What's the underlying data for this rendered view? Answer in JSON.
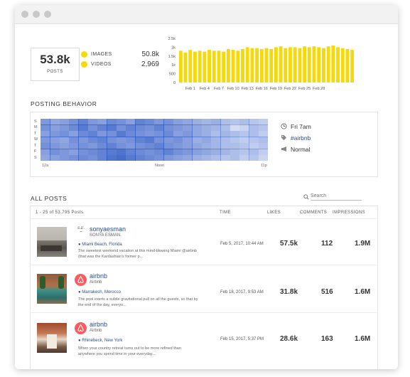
{
  "summary": {
    "total_posts": "53.8k",
    "total_label": "POSTS",
    "images_label": "IMAGES",
    "images_value": "50.8k",
    "videos_label": "VIDEOS",
    "videos_value": "2,969",
    "images_color": "#f5d90a",
    "videos_color": "#f5d90a"
  },
  "chart_data": {
    "type": "bar",
    "y_ticks": [
      "2.5k",
      "2k",
      "1.5k",
      "1k",
      "500",
      "0"
    ],
    "ylim": [
      0,
      2500
    ],
    "x_tick_labels": [
      "Feb 1",
      "Feb 4",
      "Feb 7",
      "Feb 10",
      "Feb 13",
      "Feb 16",
      "Feb 19",
      "Feb 22",
      "Feb 25",
      "Feb 28"
    ],
    "values": [
      1800,
      1700,
      1850,
      1750,
      1800,
      1750,
      1850,
      1800,
      1800,
      1750,
      1900,
      1850,
      1800,
      1900,
      2000,
      1950,
      1950,
      1900,
      1950,
      1900,
      2000,
      2050,
      1950,
      2000,
      2000,
      1950,
      2050,
      2000,
      2050,
      2000,
      1950,
      2050,
      2100,
      2000,
      1950,
      1900,
      1850
    ],
    "bar_color": "#f5d90a"
  },
  "posting_behavior": {
    "title": "POSTING BEHAVIOR",
    "day_labels": [
      "S",
      "M",
      "T",
      "W",
      "T",
      "F",
      "S"
    ],
    "x_labels": [
      "12a",
      "Noon",
      "11p"
    ],
    "intensity": [
      [
        0.55,
        0.45,
        0.5,
        0.6,
        0.7,
        0.55,
        0.5,
        0.65,
        0.6,
        0.5,
        0.7,
        0.65,
        0.55,
        0.6,
        0.5,
        0.45,
        0.4,
        0.35,
        0.4,
        0.3,
        0.25,
        0.3,
        0.25,
        0.2
      ],
      [
        0.6,
        0.5,
        0.55,
        0.65,
        0.75,
        0.6,
        0.7,
        0.75,
        0.6,
        0.7,
        0.65,
        0.6,
        0.7,
        0.6,
        0.55,
        0.5,
        0.45,
        0.4,
        0.35,
        0.3,
        0.1,
        0.15,
        0.3,
        0.25
      ],
      [
        0.5,
        0.55,
        0.6,
        0.5,
        0.65,
        0.7,
        0.55,
        0.6,
        0.75,
        0.65,
        0.6,
        0.55,
        0.6,
        0.65,
        0.5,
        0.55,
        0.45,
        0.4,
        0.3,
        0.35,
        0.3,
        0.25,
        0.3,
        0.2
      ],
      [
        0.55,
        0.5,
        0.45,
        0.6,
        0.55,
        0.65,
        0.7,
        0.6,
        0.55,
        0.6,
        0.7,
        0.75,
        0.6,
        0.55,
        0.6,
        0.5,
        0.4,
        0.45,
        0.35,
        0.3,
        0.25,
        0.2,
        0.25,
        0.3
      ],
      [
        0.6,
        0.55,
        0.5,
        0.55,
        0.6,
        0.55,
        0.65,
        0.7,
        0.6,
        0.55,
        0.6,
        0.65,
        0.7,
        0.6,
        0.55,
        0.5,
        0.45,
        0.4,
        0.35,
        0.3,
        0.3,
        0.25,
        0.2,
        0.25
      ],
      [
        0.5,
        0.6,
        0.55,
        0.5,
        0.6,
        0.65,
        0.7,
        0.75,
        0.8,
        0.7,
        0.65,
        0.6,
        0.65,
        0.7,
        0.6,
        0.55,
        0.5,
        0.45,
        0.4,
        0.35,
        0.3,
        0.25,
        0.3,
        0.2
      ],
      [
        0.45,
        0.5,
        0.55,
        0.6,
        0.65,
        0.6,
        0.7,
        0.8,
        0.85,
        0.75,
        0.7,
        0.65,
        0.6,
        0.55,
        0.5,
        0.45,
        0.4,
        0.35,
        0.3,
        0.25,
        0.3,
        0.2,
        0.25,
        0.15
      ]
    ],
    "heat_color": "#2a55c4",
    "best_time": "Fri 7am",
    "top_hashtag": "#airbnb",
    "frequency": "Normal"
  },
  "posts": {
    "title": "ALL POSTS",
    "search_placeholder": "Search",
    "range_label": "1 - 25 of 53,795 Posts",
    "columns": [
      "TIME",
      "LIKES",
      "COMMENTS",
      "IMPRESSIONS"
    ],
    "rows": [
      {
        "username": "sonyaesman",
        "display_name": "SONYA ESMAN.",
        "location": "Miami Beach, Florida",
        "caption": "The sweetest weekend vacation at this mind-blowing Miami @airbnb (that was the Kardashian's former p...",
        "time": "Feb 5, 2017, 10:44 AM",
        "likes": "57.5k",
        "comments": "112",
        "impressions": "1.9M",
        "avatar": "logo"
      },
      {
        "username": "airbnb",
        "display_name": "Airbnb",
        "location": "Marrakesh, Morocco",
        "caption": "The pool exerts a subtle gravitational pull on all the guests, so that by the end of the day, everyo...",
        "time": "Feb 18, 2017, 9:53 AM",
        "likes": "31.8k",
        "comments": "516",
        "impressions": "1.6M",
        "avatar": "airbnb"
      },
      {
        "username": "airbnb",
        "display_name": "Airbnb",
        "location": "Rhinebeck, New York",
        "caption": "When your country retreat turns out to be more refined than anywhere you spend time in your everyday...",
        "time": "Feb 15, 2017, 5:37 PM",
        "likes": "28.6k",
        "comments": "163",
        "impressions": "1.6M",
        "avatar": "airbnb"
      }
    ]
  }
}
